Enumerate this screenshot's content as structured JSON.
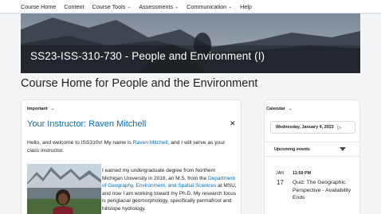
{
  "nav": {
    "items": [
      {
        "label": "Course Home",
        "dropdown": false
      },
      {
        "label": "Content",
        "dropdown": false
      },
      {
        "label": "Course Tools",
        "dropdown": true
      },
      {
        "label": "Assessments",
        "dropdown": true
      },
      {
        "label": "Communication",
        "dropdown": true
      },
      {
        "label": "Help",
        "dropdown": false
      }
    ]
  },
  "banner": {
    "title": "SS23-ISS-310-730 - People and Environment (I)"
  },
  "page": {
    "title": "Course Home for People and the Environment"
  },
  "important": {
    "widget_title": "Important",
    "instructor_heading": "Your Instructor: Raven Mitchell",
    "intro_before": "Hello, and welcome to ISS310v! My name is ",
    "intro_link": "Raven Mitchell",
    "intro_after": ", and I will serve as your class instructor.",
    "bio_before": "I earned my undergraduate degree from Northern Michigan University in 2018, an M.S. from the ",
    "bio_link": "Department of Geography, Environment, and Spatial Sciences",
    "bio_after": " at MSU, and now I am working toward my Ph.D. My research focus is periglacial geomorphology, specifically permafrost and hillslope hydrology."
  },
  "calendar": {
    "widget_title": "Calendar",
    "current_date": "Wednesday, January 4, 2023",
    "upcoming_label": "Upcoming events",
    "events": [
      {
        "month": "JAN",
        "day": "17",
        "time": "11:59 PM",
        "title": "Quiz: The Geographic Perspective - Availability Ends"
      }
    ]
  },
  "colors": {
    "link": "#006fbf",
    "text": "#202122",
    "background": "#f4f5f6"
  }
}
